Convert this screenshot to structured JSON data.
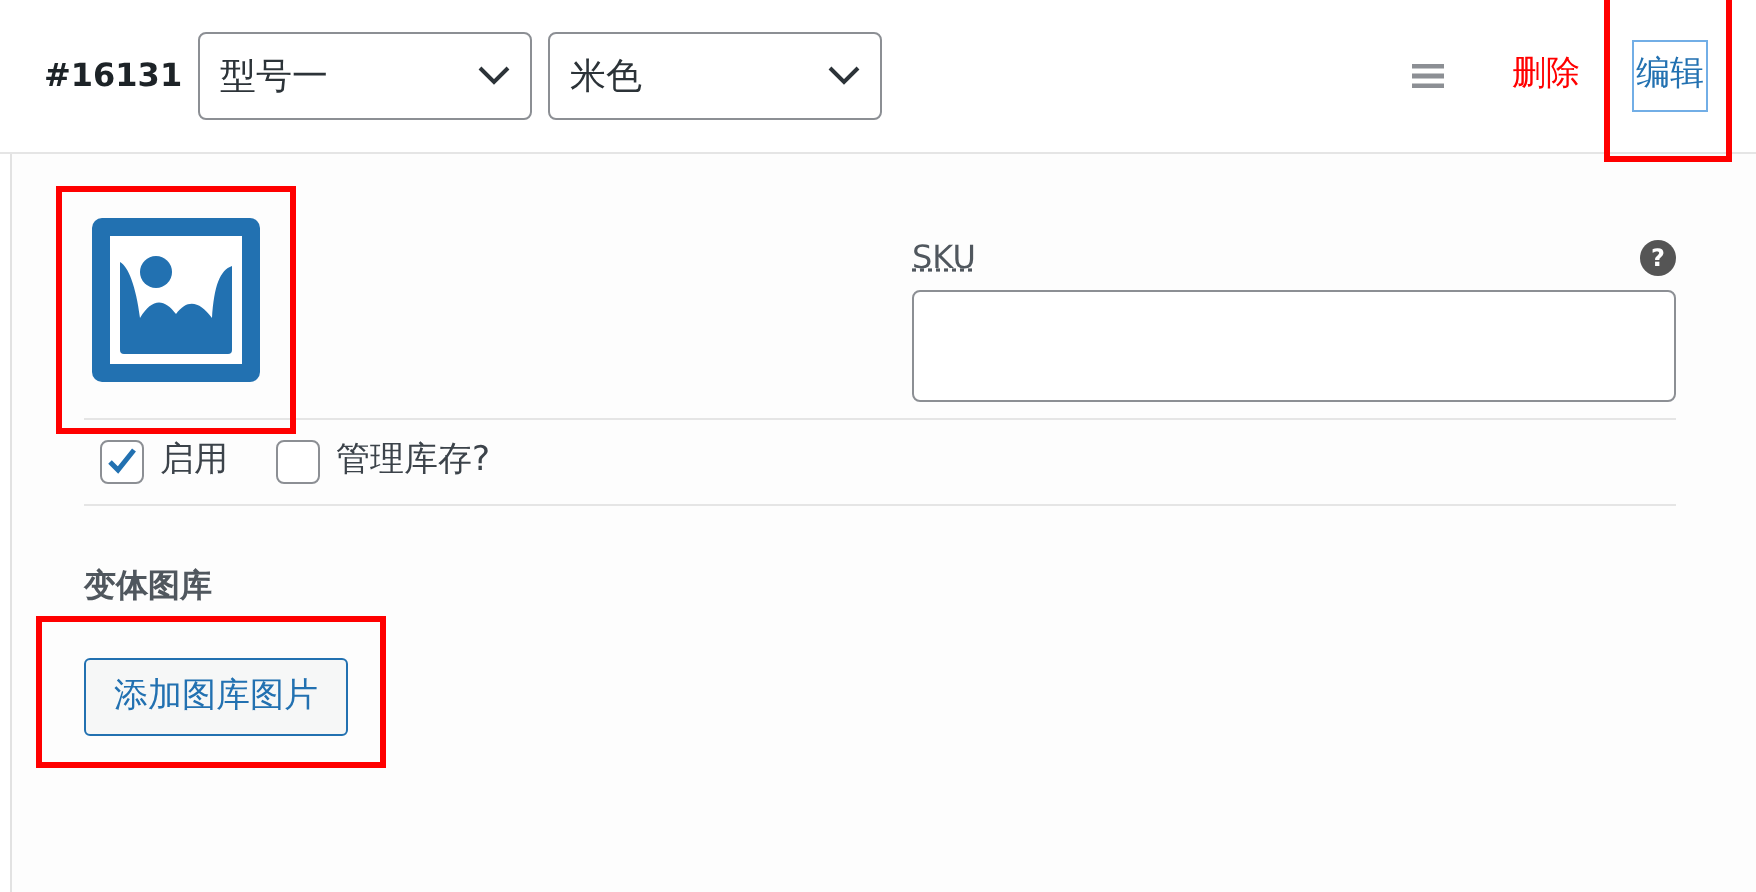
{
  "variation": {
    "id": "#16131",
    "selects": [
      {
        "value": "型号一"
      },
      {
        "value": "米色"
      }
    ],
    "actions": [
      {
        "kind": "menu"
      },
      {
        "kind": "link",
        "label": "删除"
      },
      {
        "kind": "link",
        "label": "编辑",
        "highlighted": true
      }
    ]
  },
  "image": {
    "highlighted": true
  },
  "sku": {
    "label": "SKU",
    "help": "?"
  },
  "options": [
    {
      "label": "启用",
      "checked": true
    },
    {
      "label": "管理库存?",
      "checked": false
    }
  ],
  "gallery": {
    "heading": "变体图库",
    "button": "添加图库图片",
    "highlighted": true
  }
}
